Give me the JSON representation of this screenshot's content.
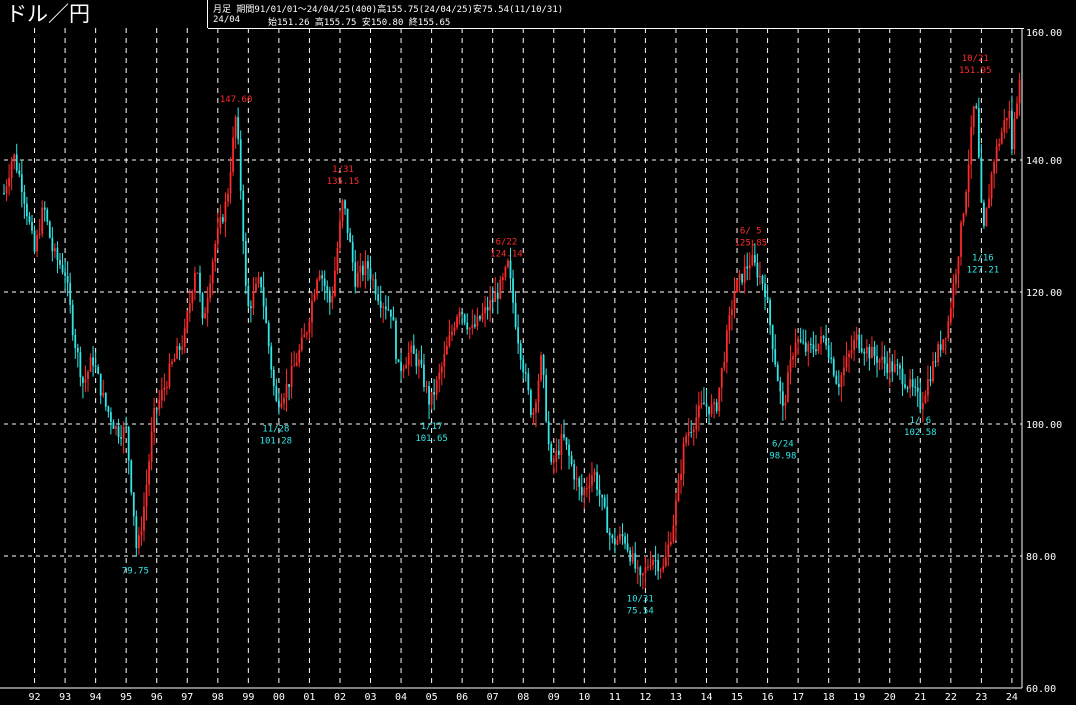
{
  "header": {
    "title": "ドル／円",
    "line1": "月足 期間91/01/01～24/04/25(400)高155.75(24/04/25)安75.54(11/10/31)",
    "line2_period": "24/04",
    "line2_ohlc": "始151.26 高155.75 安150.80 終155.65"
  },
  "colors": {
    "up": "#ff2a2a",
    "down": "#33e6e6",
    "grid": "#ffffff",
    "background": "#000000"
  },
  "chart_data": {
    "type": "candlestick",
    "title": "ドル／円",
    "ylim": [
      60,
      160
    ],
    "yticks": [
      "160.00",
      "140.00",
      "120.00",
      "100.00",
      "80.00",
      "60.00"
    ],
    "xticks": [
      "92",
      "93",
      "94",
      "95",
      "96",
      "97",
      "98",
      "99",
      "00",
      "01",
      "02",
      "03",
      "04",
      "05",
      "06",
      "07",
      "08",
      "09",
      "10",
      "11",
      "12",
      "13",
      "14",
      "15",
      "16",
      "17",
      "18",
      "19",
      "20",
      "21",
      "22",
      "23",
      "24"
    ],
    "x_start": 1991.0,
    "x_end": 2024.33,
    "series_anchors": [
      [
        1991.0,
        135
      ],
      [
        1991.3,
        141
      ],
      [
        1991.6,
        136
      ],
      [
        1992.0,
        126
      ],
      [
        1992.3,
        133
      ],
      [
        1992.6,
        126
      ],
      [
        1993.0,
        123
      ],
      [
        1993.3,
        113
      ],
      [
        1993.6,
        106
      ],
      [
        1993.9,
        110
      ],
      [
        1994.3,
        103
      ],
      [
        1994.7,
        99
      ],
      [
        1995.0,
        99
      ],
      [
        1995.3,
        84
      ],
      [
        1995.35,
        80
      ],
      [
        1995.6,
        88
      ],
      [
        1995.9,
        101
      ],
      [
        1996.5,
        109
      ],
      [
        1996.9,
        113
      ],
      [
        1997.3,
        125
      ],
      [
        1997.5,
        115
      ],
      [
        1997.9,
        127
      ],
      [
        1998.3,
        134
      ],
      [
        1998.6,
        147
      ],
      [
        1998.8,
        132
      ],
      [
        1998.95,
        117
      ],
      [
        1999.4,
        122
      ],
      [
        1999.9,
        103
      ],
      [
        2000.3,
        106
      ],
      [
        2000.9,
        114
      ],
      [
        2001.3,
        124
      ],
      [
        2001.7,
        118
      ],
      [
        2002.1,
        134
      ],
      [
        2002.5,
        122
      ],
      [
        2002.9,
        124
      ],
      [
        2003.3,
        119
      ],
      [
        2003.7,
        117
      ],
      [
        2003.9,
        108
      ],
      [
        2004.3,
        111
      ],
      [
        2004.6,
        109
      ],
      [
        2004.95,
        103
      ],
      [
        2005.3,
        108
      ],
      [
        2005.9,
        118
      ],
      [
        2006.3,
        114
      ],
      [
        2006.9,
        118
      ],
      [
        2007.3,
        121
      ],
      [
        2007.5,
        124
      ],
      [
        2007.8,
        114
      ],
      [
        2008.3,
        101
      ],
      [
        2008.6,
        110
      ],
      [
        2008.9,
        93
      ],
      [
        2009.3,
        98
      ],
      [
        2009.9,
        89
      ],
      [
        2010.3,
        93
      ],
      [
        2010.9,
        82
      ],
      [
        2011.3,
        83
      ],
      [
        2011.83,
        76
      ],
      [
        2012.2,
        80
      ],
      [
        2012.6,
        78
      ],
      [
        2012.95,
        86
      ],
      [
        2013.3,
        98
      ],
      [
        2013.9,
        103
      ],
      [
        2014.3,
        102
      ],
      [
        2014.9,
        120
      ],
      [
        2015.45,
        125
      ],
      [
        2015.9,
        121
      ],
      [
        2016.3,
        108
      ],
      [
        2016.5,
        102
      ],
      [
        2016.9,
        113
      ],
      [
        2017.3,
        111
      ],
      [
        2017.9,
        113
      ],
      [
        2018.3,
        106
      ],
      [
        2018.9,
        113
      ],
      [
        2019.3,
        111
      ],
      [
        2019.9,
        109
      ],
      [
        2020.3,
        108
      ],
      [
        2020.9,
        104
      ],
      [
        2021.0,
        103
      ],
      [
        2021.5,
        110
      ],
      [
        2021.9,
        115
      ],
      [
        2022.3,
        128
      ],
      [
        2022.5,
        136
      ],
      [
        2022.8,
        150
      ],
      [
        2023.05,
        128
      ],
      [
        2023.4,
        140
      ],
      [
        2023.9,
        148
      ],
      [
        2024.0,
        142
      ],
      [
        2024.3,
        155.6
      ]
    ],
    "annotations": [
      {
        "date": "",
        "value": "147.60",
        "side": "high",
        "x": 1998.6,
        "color": "up"
      },
      {
        "date": "1/31",
        "value": "135.15",
        "side": "high",
        "x": 2002.1,
        "color": "up"
      },
      {
        "date": "6/22",
        "value": "124.14",
        "side": "high",
        "x": 2007.45,
        "color": "up"
      },
      {
        "date": "6/ 5",
        "value": "125.85",
        "side": "high",
        "x": 2015.45,
        "color": "up"
      },
      {
        "date": "10/21",
        "value": "151.95",
        "side": "high",
        "x": 2022.8,
        "color": "up"
      },
      {
        "date": "",
        "value": "79.75",
        "side": "low",
        "x": 1995.3,
        "color": "down"
      },
      {
        "date": "11/28",
        "value": "101.28",
        "side": "low",
        "x": 1999.9,
        "color": "down"
      },
      {
        "date": "1/17",
        "value": "101.65",
        "side": "low",
        "x": 2005.0,
        "color": "down"
      },
      {
        "date": "10/31",
        "value": "75.54",
        "side": "low",
        "x": 2011.83,
        "color": "down"
      },
      {
        "date": "6/24",
        "value": "98.98",
        "side": "low",
        "x": 2016.5,
        "color": "down"
      },
      {
        "date": "1/ 6",
        "value": "102.58",
        "side": "low",
        "x": 2021.0,
        "color": "down"
      },
      {
        "date": "1/16",
        "value": "127.21",
        "side": "low",
        "x": 2023.05,
        "color": "down"
      }
    ]
  }
}
